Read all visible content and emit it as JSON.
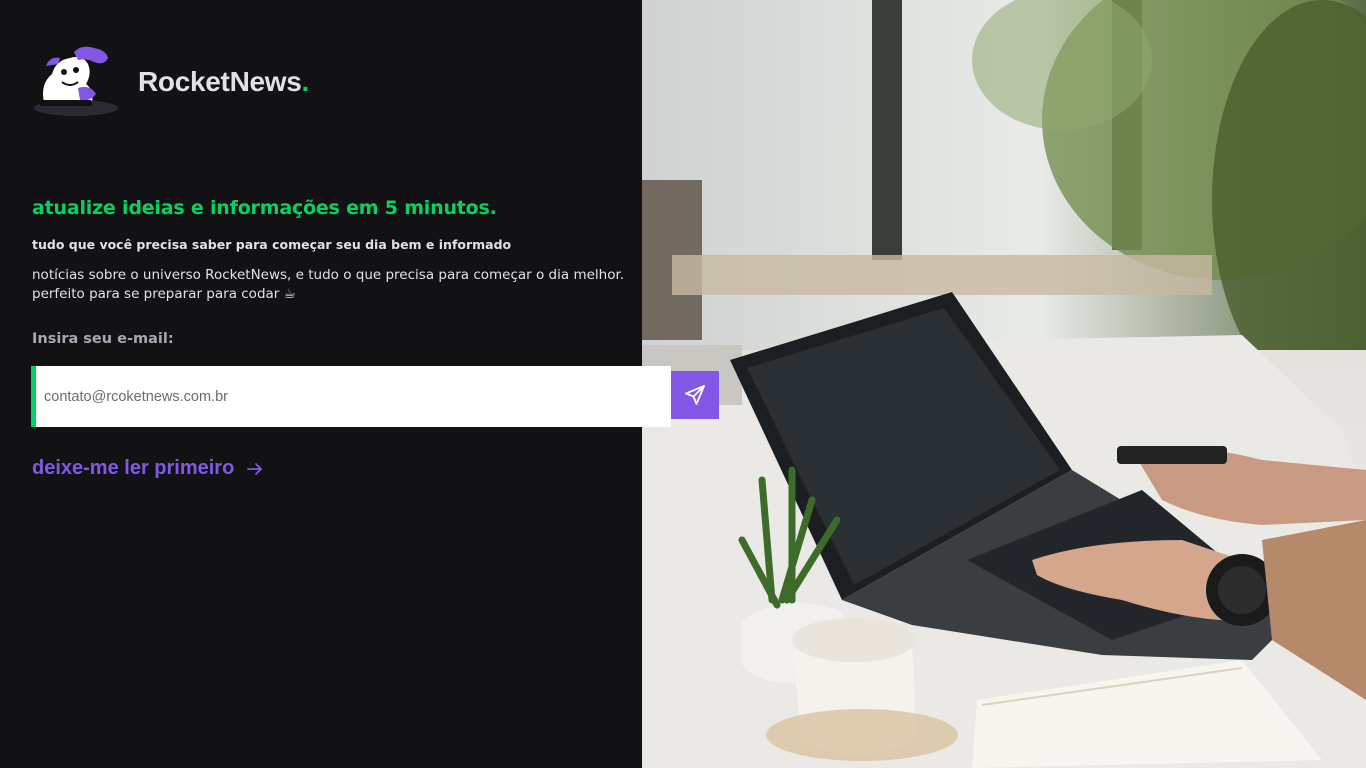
{
  "brand": {
    "name": "RocketNews",
    "dot": ".",
    "accent": "#04d361"
  },
  "hero": {
    "headline": "atualize ideias e informações em 5 minutos.",
    "subheadline": "tudo que você precisa saber para começar seu dia bem e informado",
    "description_line1": "notícias sobre o universo RocketNews, e tudo o que precisa para começar o dia melhor.",
    "description_line2": "perfeito para se preparar para codar ☕"
  },
  "form": {
    "email_label": "Insira seu e-mail:",
    "email_placeholder": "contato@rcoketnews.com.br",
    "submit_icon": "send-icon"
  },
  "link": {
    "label": "deixe-me ler primeiro",
    "icon": "arrow-right-icon"
  },
  "colors": {
    "background": "#121214",
    "primary_purple": "#8257e5",
    "green": "#04d361",
    "text": "#e1e1e6",
    "muted": "#a8a8b3"
  }
}
